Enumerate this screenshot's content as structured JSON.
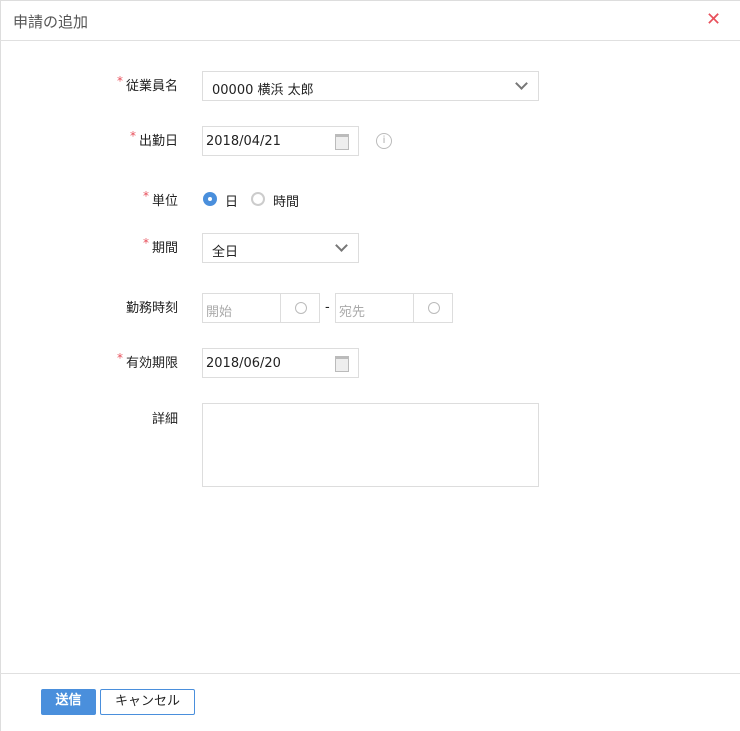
{
  "dialog": {
    "title": "申請の追加",
    "close": "✕"
  },
  "form": {
    "employee": {
      "label": "従業員名",
      "required": "*",
      "value": "00000 横浜 太郎"
    },
    "work_date": {
      "label": "出勤日",
      "required": "*",
      "value": "2018/04/21",
      "info": "i"
    },
    "unit": {
      "label": "単位",
      "required": "*",
      "options": [
        "日",
        "時間"
      ],
      "selected": "日"
    },
    "period": {
      "label": "期間",
      "required": "*",
      "value": "全日"
    },
    "work_time": {
      "label": "勤務時刻",
      "start_placeholder": "開始",
      "end_placeholder": "宛先",
      "dash": "-"
    },
    "expiry": {
      "label": "有効期限",
      "required": "*",
      "value": "2018/06/20"
    },
    "detail": {
      "label": "詳細",
      "value": ""
    }
  },
  "footer": {
    "submit": "送信",
    "cancel": "キャンセル"
  },
  "colors": {
    "accent": "#4a8fdc",
    "required": "#e8505b"
  }
}
